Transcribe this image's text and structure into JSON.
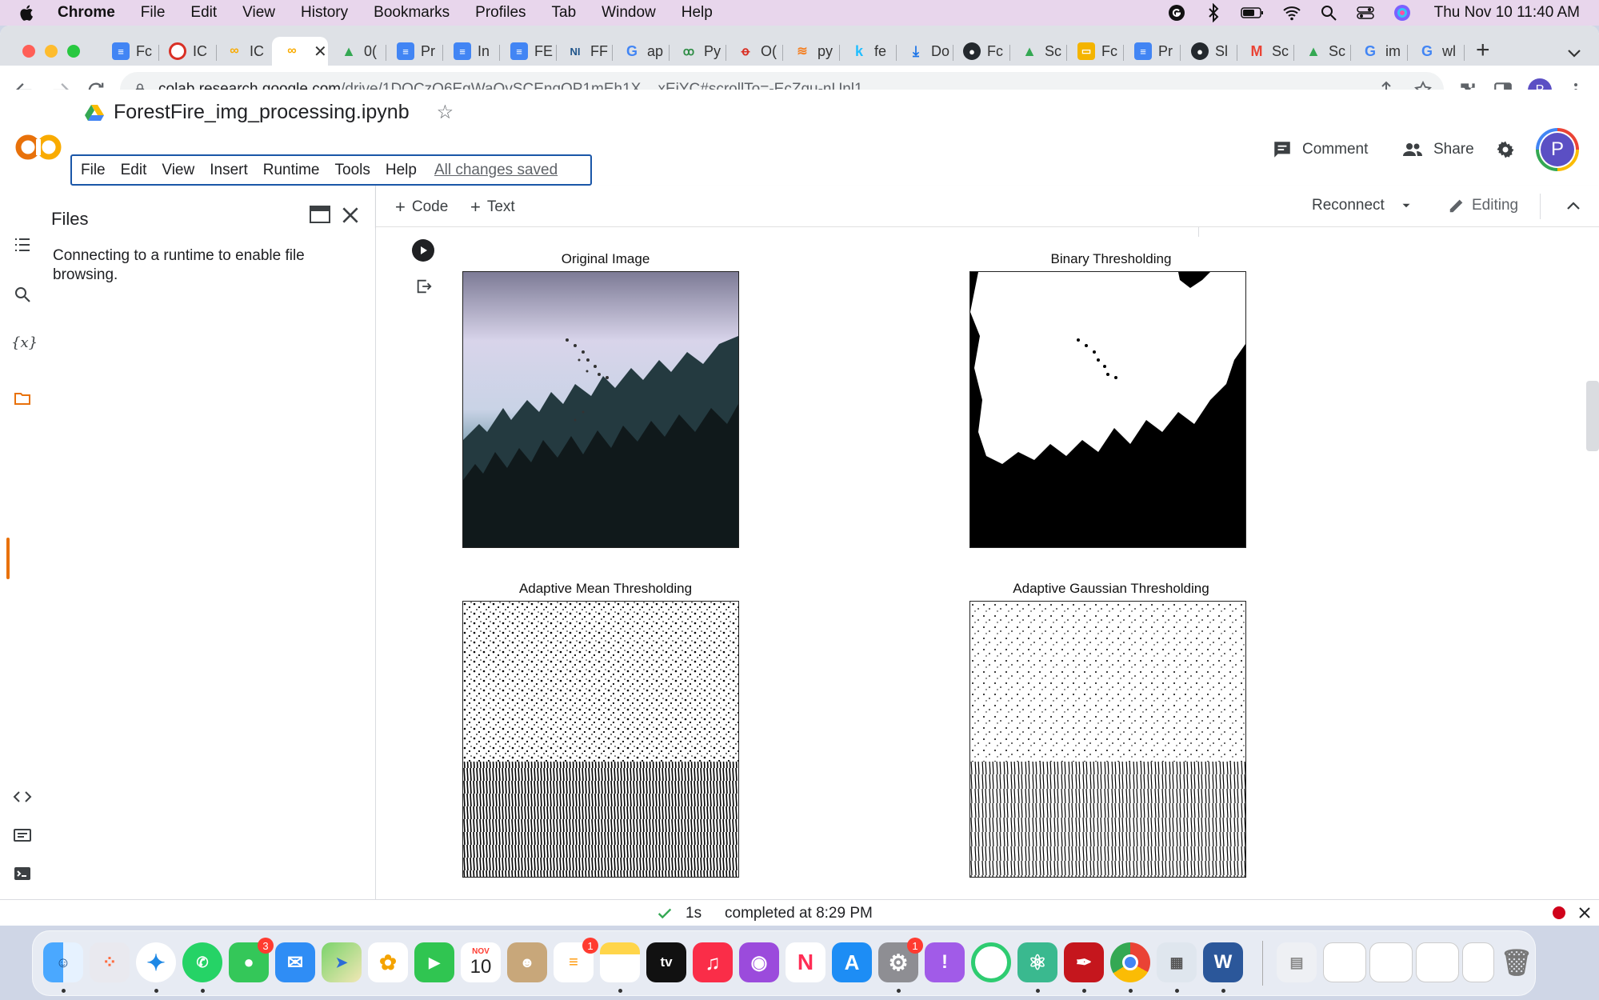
{
  "macos_menubar": {
    "app_name": "Chrome",
    "items": [
      "File",
      "Edit",
      "View",
      "History",
      "Bookmarks",
      "Profiles",
      "Tab",
      "Window",
      "Help"
    ],
    "datetime": "Thu Nov 10  11:40 AM"
  },
  "browser": {
    "tabs": [
      {
        "label": "Fc",
        "icon": "google-docs-icon",
        "color": "#4285f4",
        "active": false
      },
      {
        "label": "IC",
        "icon": "gear-favicon-icon",
        "color": "#d93025",
        "active": false
      },
      {
        "label": "IC",
        "icon": "colab-icon",
        "color": "#f9ab00",
        "active": false
      },
      {
        "label": "",
        "icon": "colab-icon",
        "color": "#f9ab00",
        "active": true
      },
      {
        "label": "0(",
        "icon": "google-drive-icon",
        "color": "#34a853",
        "active": false
      },
      {
        "label": "Pr",
        "icon": "google-docs-icon",
        "color": "#4285f4",
        "active": false
      },
      {
        "label": "In",
        "icon": "google-docs-icon",
        "color": "#4285f4",
        "active": false
      },
      {
        "label": "FE",
        "icon": "google-docs-icon",
        "color": "#4285f4",
        "active": false
      },
      {
        "label": "FF",
        "icon": "nih-icon",
        "color": "#20558a",
        "active": false
      },
      {
        "label": "ap",
        "icon": "google-search-icon",
        "color": "#4285f4",
        "active": false
      },
      {
        "label": "Py",
        "icon": "geeksforgeeks-icon",
        "color": "#2f8d46",
        "active": false
      },
      {
        "label": "O(",
        "icon": "pdf-icon",
        "color": "#d93025",
        "active": false
      },
      {
        "label": "py",
        "icon": "stackoverflow-icon",
        "color": "#f48024",
        "active": false
      },
      {
        "label": "fe",
        "icon": "kaggle-icon",
        "color": "#20beff",
        "active": false
      },
      {
        "label": "Do",
        "icon": "download-icon",
        "color": "#1a73e8",
        "active": false
      },
      {
        "label": "Fc",
        "icon": "github-icon",
        "color": "#24292e",
        "active": false
      },
      {
        "label": "Sc",
        "icon": "google-drive-icon",
        "color": "#34a853",
        "active": false
      },
      {
        "label": "Fc",
        "icon": "google-slides-icon",
        "color": "#f4b400",
        "active": false
      },
      {
        "label": "Pr",
        "icon": "google-docs-icon",
        "color": "#4285f4",
        "active": false
      },
      {
        "label": "Sl",
        "icon": "github-icon",
        "color": "#24292e",
        "active": false
      },
      {
        "label": "Sc",
        "icon": "gmail-icon",
        "color": "#ea4335",
        "active": false
      },
      {
        "label": "Sc",
        "icon": "google-drive-icon",
        "color": "#34a853",
        "active": false
      },
      {
        "label": "im",
        "icon": "google-search-icon",
        "color": "#4285f4",
        "active": false
      },
      {
        "label": "wl",
        "icon": "google-search-icon",
        "color": "#4285f4",
        "active": false
      }
    ],
    "url_host": "colab.research.google.com",
    "url_path": "/drive/1DQCzQ6EgWaOvSCEnqOP1mEh1X__xEjYC#scrollTo=-EcZqu-nUnl1",
    "profile_letter": "P"
  },
  "colab": {
    "notebook_title": "ForestFire_img_processing.ipynb",
    "menu": [
      "File",
      "Edit",
      "View",
      "Insert",
      "Runtime",
      "Tools",
      "Help"
    ],
    "save_status": "All changes saved",
    "comment_label": "Comment",
    "share_label": "Share",
    "avatar_letter": "P",
    "toolbar": {
      "code_label": "Code",
      "text_label": "Text",
      "reconnect_label": "Reconnect",
      "editing_label": "Editing"
    },
    "files_panel": {
      "title": "Files",
      "message": "Connecting to a runtime to enable file browsing."
    },
    "rail_var_label": "{x}",
    "output_figures": [
      {
        "title": "Original Image"
      },
      {
        "title": "Binary Thresholding"
      },
      {
        "title": "Adaptive Mean Thresholding"
      },
      {
        "title": "Adaptive Gaussian Thresholding"
      }
    ],
    "status": {
      "duration": "1s",
      "text": "completed at 8:29 PM"
    }
  },
  "dock": {
    "calendar_month": "NOV",
    "calendar_day": "10",
    "messages_badge": "3",
    "reminders_badge": "1",
    "settings_badge": "1",
    "tv_label": "tv"
  }
}
